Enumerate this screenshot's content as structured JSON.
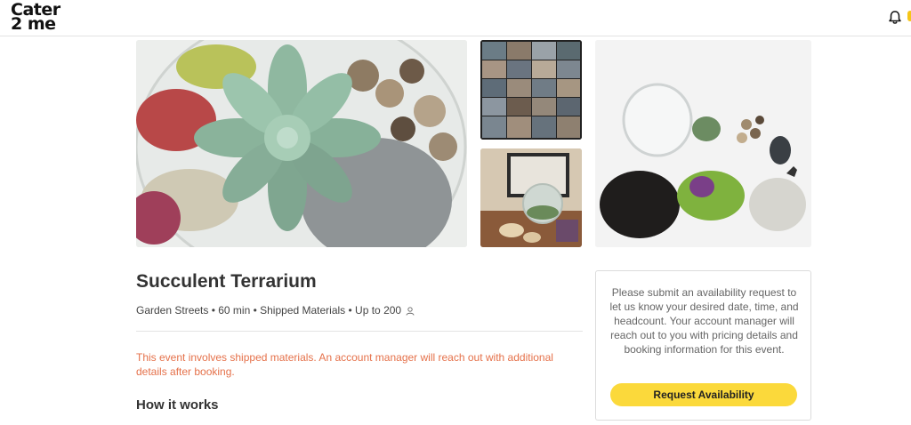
{
  "header": {
    "logo_line1": "Cater",
    "logo_line2": "2 me",
    "notification_icon": "bell-icon"
  },
  "gallery": [
    {
      "name": "succulent-terrarium-photo",
      "subject": "succulent in glass terrarium"
    },
    {
      "name": "virtual-event-grid-photo",
      "subject": "video call grid of participants"
    },
    {
      "name": "desk-terrarium-photo",
      "subject": "terrarium on desk with laptop"
    },
    {
      "name": "terrarium-kit-photo",
      "subject": "terrarium kit materials"
    }
  ],
  "event": {
    "title": "Succulent Terrarium",
    "meta": "Garden Streets • 60 min • Shipped Materials • Up to 200",
    "meta_icon": "person-icon",
    "notice": "This event involves shipped materials. An account manager will reach out with additional details after booking.",
    "how_it_works": "How it works"
  },
  "availability_card": {
    "text": "Please submit an availability request to let us know your desired date, time, and headcount. Your account manager will reach out to you with pricing details and booking information for this event.",
    "button_label": "Request Availability"
  },
  "colors": {
    "accent_yellow": "#fbd93b",
    "notice_orange": "#e5714a",
    "text_dark": "#333333"
  }
}
